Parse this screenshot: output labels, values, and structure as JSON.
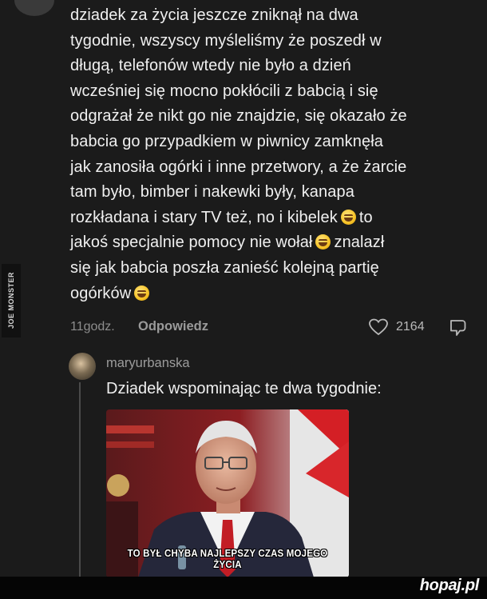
{
  "comment": {
    "lines": [
      "dziadek za życia jeszcze zniknął na dwa",
      "tygodnie, wszyscy myśleliśmy że poszedł w",
      "długą, telefonów wtedy nie było a dzień",
      "wcześniej się mocno pokłócili z babcią i się",
      "odgrażał że nikt go nie znajdzie, się okazało że",
      "babcia go przypadkiem w piwnicy zamknęła",
      "jak zanosiła ogórki i inne przetwory, a że żarcie",
      "tam było, bimber i nakewki były, kanapa",
      "rozkładana i stary TV też, no i kibelek",
      "to",
      "jakoś specjalnie pomocy nie wołał",
      "znalazł",
      "się jak babcia poszła zanieść kolejną partię",
      "ogórków"
    ],
    "emoji_icons": [
      "grinning-sweat-emoji",
      "laughing-tears-emoji",
      "laughing-tears-emoji"
    ],
    "time": "11godz.",
    "reply_label": "Odpowiedz",
    "like_count": "2164"
  },
  "watermark": "JOE MONSTER",
  "reply": {
    "username": "maryurbanska",
    "text": "Dziadek wspominając te dwa tygodnie:",
    "image_caption": "TO BYŁ CHYBA NAJLEPSZY CZAS MOJEGO ŻYCIA"
  },
  "footer": {
    "brand": "hopaj.pl"
  },
  "colors": {
    "background": "#1b1b1b",
    "text": "#f0f0f0",
    "muted": "#8d8d8d"
  }
}
